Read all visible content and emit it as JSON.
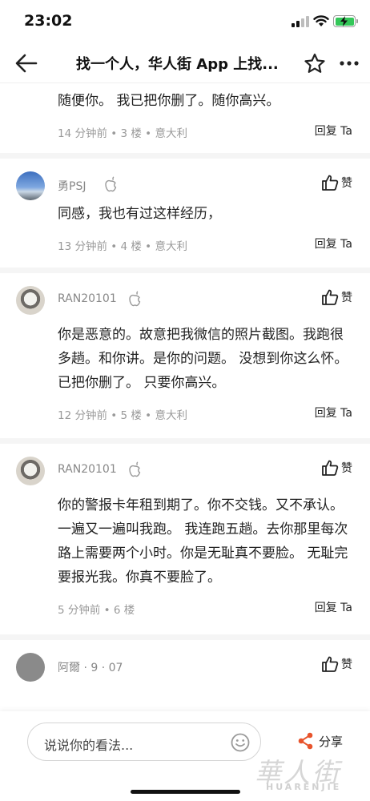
{
  "status_bar": {
    "time": "23:02"
  },
  "nav": {
    "title": "找一个人，华人街 App 上找..."
  },
  "comments": [
    {
      "text": "随便你。 我已把你删了。随你高兴。",
      "meta": "14 分钟前 • 3 楼 • 意大利",
      "reply_label": "回复 Ta"
    },
    {
      "username": "勇PSJ",
      "like_label": "赞",
      "text": "同感，我也有过这样经历，",
      "meta": "13 分钟前 • 4 楼 • 意大利",
      "reply_label": "回复 Ta"
    },
    {
      "username": "RAN20101",
      "like_label": "赞",
      "text": "你是恶意的。故意把我微信的照片截图。我跑很多趟。和你讲。是你的问题。 没想到你这么怀。 已把你删了。 只要你高兴。",
      "meta": "12 分钟前 • 5 楼 • 意大利",
      "reply_label": "回复 Ta"
    },
    {
      "username": "RAN20101",
      "like_label": "赞",
      "text": "你的警报卡年租到期了。你不交钱。又不承认。一遍又一遍叫我跑。 我连跑五趟。去你那里每次路上需要两个小时。你是无耻真不要脸。 无耻完要报光我。你真不要脸了。",
      "meta": "5 分钟前 • 6 楼",
      "reply_label": "回复 Ta"
    },
    {
      "username": "阿爾 · 9 · 07",
      "like_label": "赞"
    }
  ],
  "bottom_bar": {
    "input_placeholder": "说说你的看法...",
    "share_label": "分享"
  },
  "watermark": {
    "main": "華人街",
    "sub": "HUARENJIE"
  }
}
